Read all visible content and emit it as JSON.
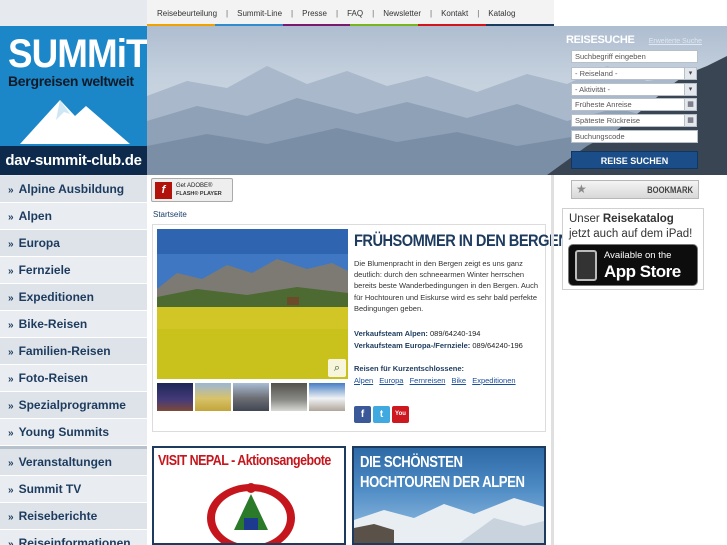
{
  "topnav": {
    "items": [
      "Reisebeurteilung",
      "Summit-Line",
      "Presse",
      "FAQ",
      "Newsletter",
      "Kontakt",
      "Katalog"
    ],
    "separator": "|",
    "stripe_colors": [
      "#f2a200",
      "#2e8ccf",
      "#7a1a6e",
      "#7ab51d",
      "#d4141b",
      "#1d3b5e"
    ]
  },
  "logo": {
    "brand": "SUMMiT",
    "tagline": "Bergreisen weltweit",
    "domain": "dav-summit-club.de"
  },
  "sidebar": {
    "items": [
      {
        "label": "Alpine Ausbildung"
      },
      {
        "label": "Alpen"
      },
      {
        "label": "Europa"
      },
      {
        "label": "Fernziele"
      },
      {
        "label": "Expeditionen"
      },
      {
        "label": "Bike-Reisen"
      },
      {
        "label": "Familien-Reisen"
      },
      {
        "label": "Foto-Reisen"
      },
      {
        "label": "Spezialprogramme"
      },
      {
        "label": "Young Summits"
      },
      {
        "label": "Veranstaltungen"
      },
      {
        "label": "Summit TV"
      },
      {
        "label": "Reiseberichte"
      },
      {
        "label": "Reiseinformationen"
      }
    ]
  },
  "search": {
    "title": "REISESUCHE",
    "advanced_link": "Erweiterte Suche",
    "keyword_placeholder": "Suchbegriff eingeben",
    "country_select": "- Reiseland -",
    "activity_select": "- Aktivität -",
    "earliest_placeholder": "Früheste Anreise",
    "latest_placeholder": "Späteste Rückreise",
    "booking_placeholder": "Buchungscode",
    "submit_label": "REISE SUCHEN"
  },
  "flash": {
    "line1": "Get ADOBE®",
    "line2": "FLASH® PLAYER"
  },
  "breadcrumb": "Startseite",
  "feature": {
    "title": "FRÜHSOMMER IN DEN BERGEN",
    "text": "Die Blumenpracht in den Bergen zeigt es uns ganz deutlich: durch den schneearmen Winter herrschen bereits beste Wanderbedingungen in den Bergen. Auch für Hochtouren und Eiskurse wird es sehr bald perfekte Bedingungen geben.",
    "team_alpen_label": "Verkaufsteam Alpen:",
    "team_alpen_phone": "089/64240-194",
    "team_europa_label": "Verkaufsteam Europa-/Fernziele:",
    "team_europa_phone": "089/64240-196",
    "short_trips_title": "Reisen für Kurzentschlossene:",
    "short_trips_links": [
      "Alpen",
      "Europa",
      "Fernreisen",
      "Bike",
      "Expeditionen"
    ]
  },
  "banners": {
    "nepal_title": "VISIT NEPAL - Aktionsangebote",
    "alpen_line1": "DIE SCHÖNSTEN",
    "alpen_line2": "HOCHTOUREN DER ALPEN"
  },
  "right": {
    "bookmark_label": "BOOKMARK",
    "catalog_prefix": "Unser ",
    "catalog_bold": "Reisekatalog",
    "catalog_line2": "jetzt auch auf dem iPad!",
    "appstore_line1": "Available on the",
    "appstore_line2": "App Store"
  },
  "social": [
    {
      "icon": "facebook-icon",
      "glyph": "f",
      "color": "#3b5998"
    },
    {
      "icon": "twitter-icon",
      "glyph": "t",
      "color": "#3fa9e0"
    },
    {
      "icon": "youtube-icon",
      "glyph": "You",
      "color": "#cc181e"
    }
  ]
}
